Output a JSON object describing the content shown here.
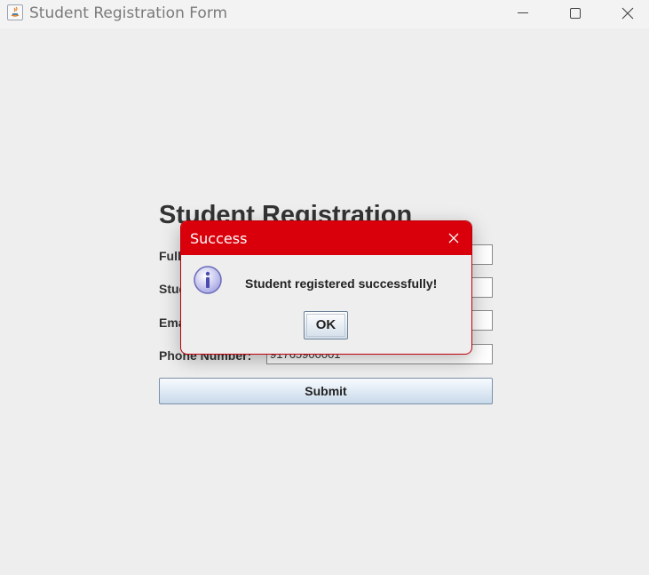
{
  "window": {
    "title": "Student Registration Form"
  },
  "form": {
    "title": "Student Registration",
    "labels": {
      "full_name": "Full Name:",
      "student_id": "Student ID:",
      "email": "Email:",
      "phone": "Phone Number:"
    },
    "values": {
      "phone": "91765900001"
    },
    "submit_label": "Submit"
  },
  "dialog": {
    "title": "Success",
    "message": "Student registered successfully!",
    "ok_label": "OK",
    "header_color": "#d9000b",
    "icon": "info-icon"
  },
  "icons": [
    "java-app-icon",
    "minimize-icon",
    "maximize-icon",
    "close-icon"
  ]
}
